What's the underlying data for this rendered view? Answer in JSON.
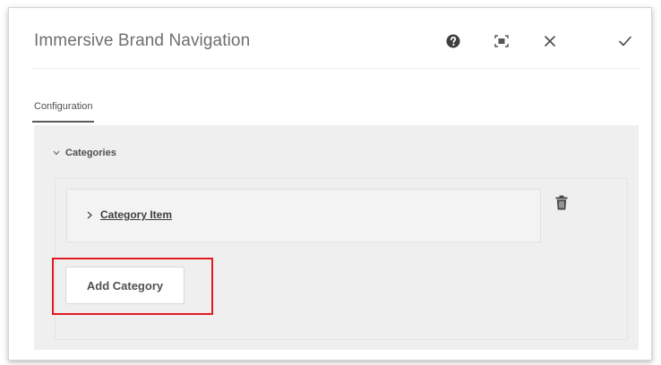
{
  "dialog": {
    "title": "Immersive Brand Navigation",
    "header_icons": [
      "help-icon",
      "fullscreen-icon",
      "close-icon",
      "checkmark-icon"
    ]
  },
  "tabs": [
    {
      "label": "Configuration",
      "active": true
    }
  ],
  "categories": {
    "label": "Categories",
    "expanded": true,
    "items": [
      {
        "label": "Category Item",
        "expanded": false
      }
    ],
    "add_button_label": "Add Category"
  },
  "colors": {
    "panel_bg": "#efefef",
    "highlight": "#e21b23",
    "text": "#505050"
  }
}
